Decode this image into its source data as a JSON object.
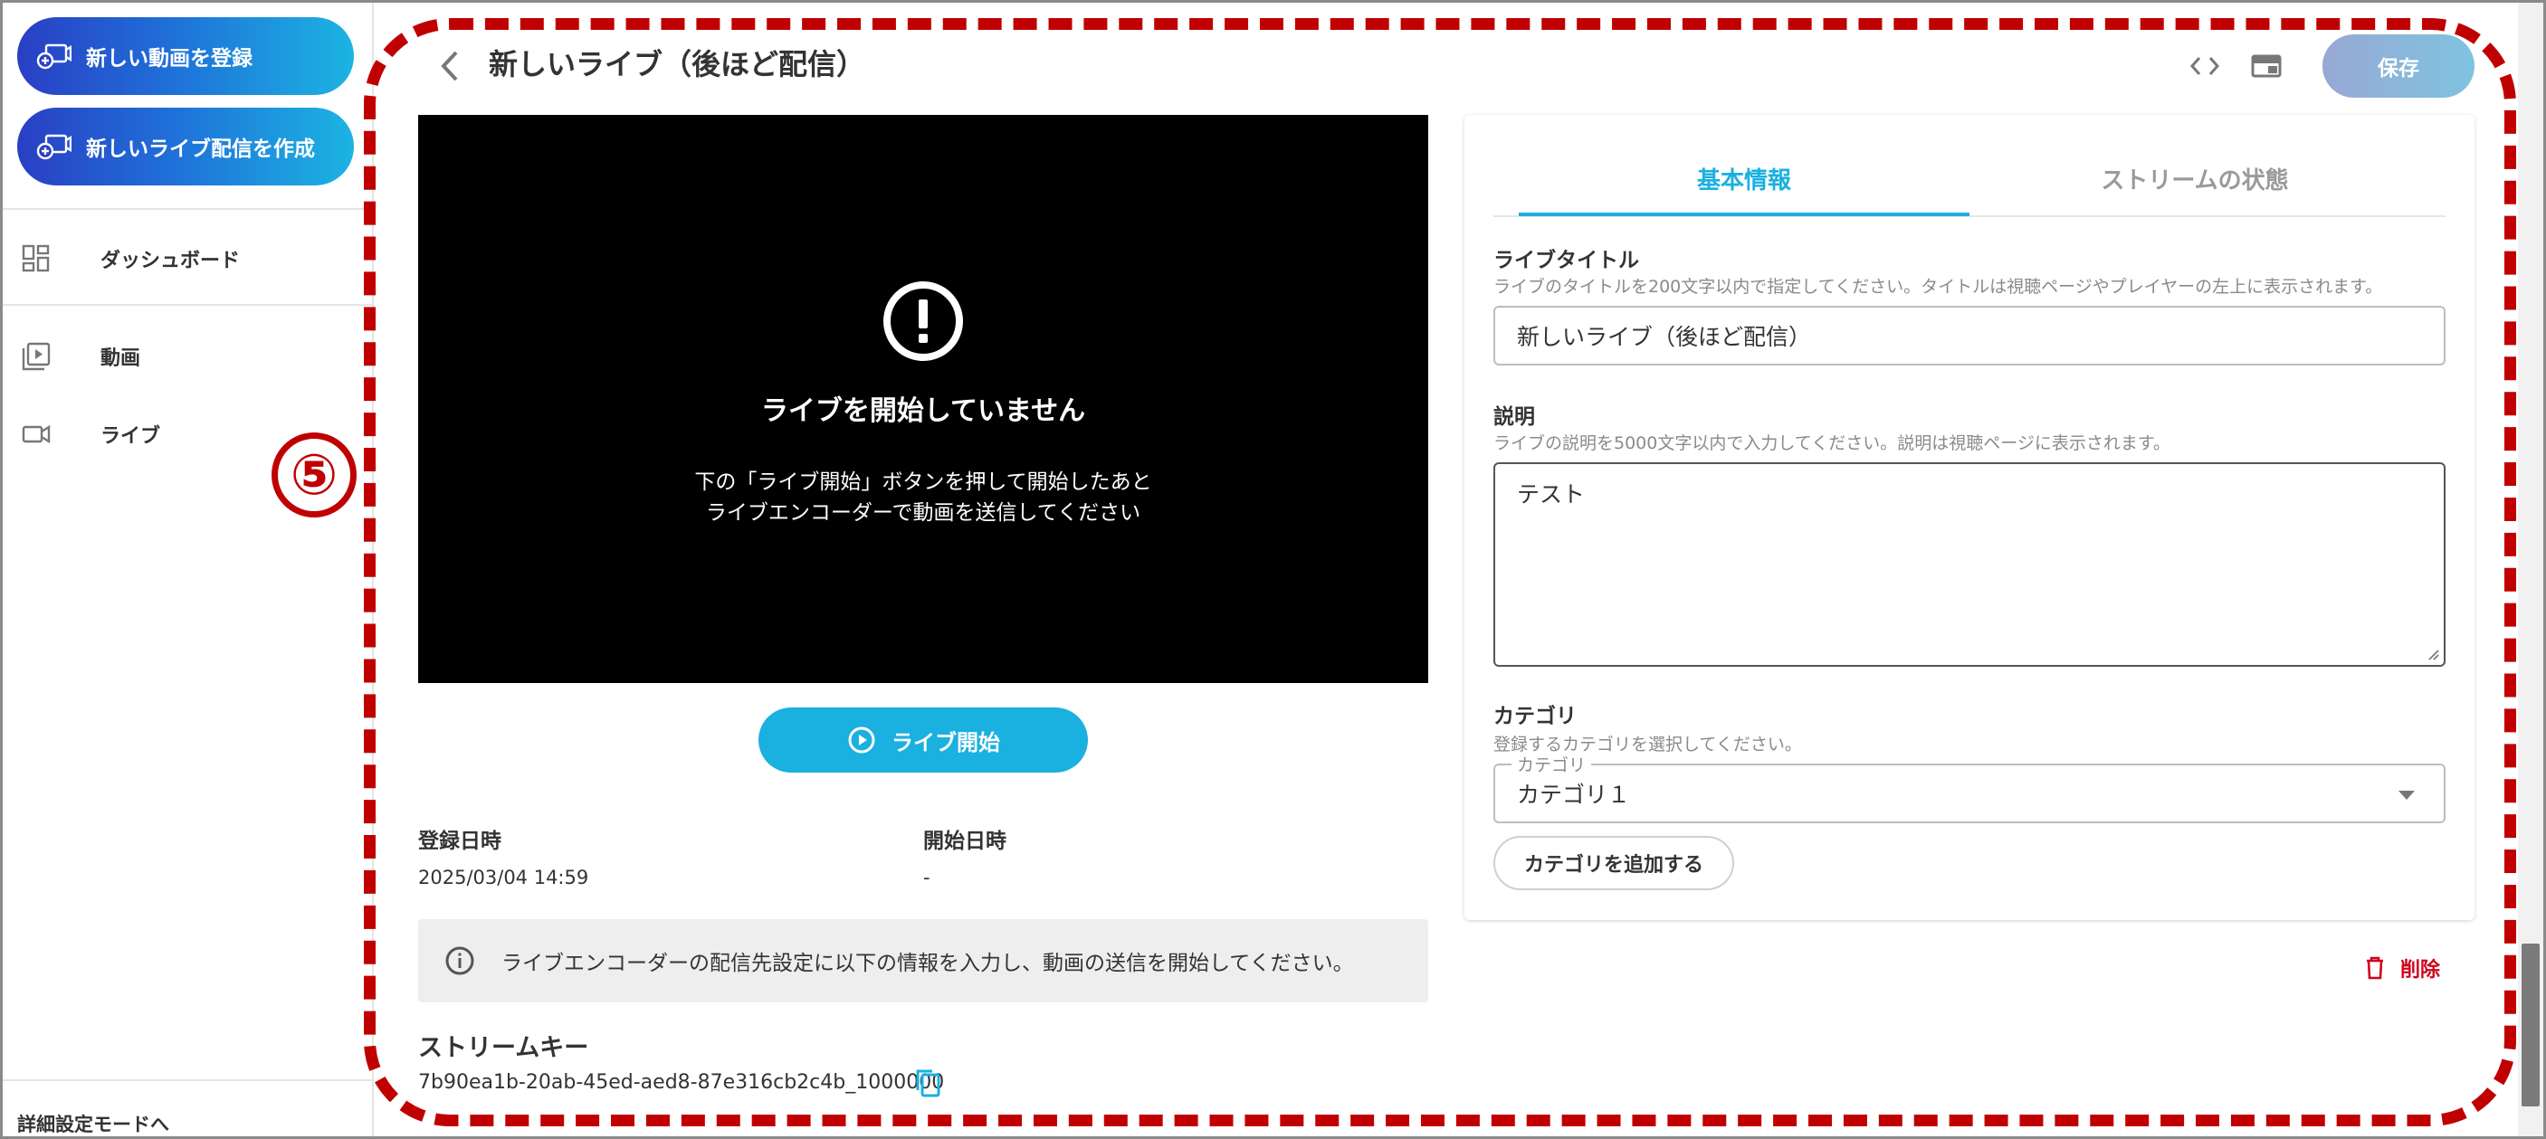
{
  "sidebar": {
    "new_video_button": "新しい動画を登録",
    "new_live_button": "新しいライブ配信を作成",
    "items": [
      {
        "label": "ダッシュボード",
        "icon": "dashboard-icon"
      },
      {
        "label": "動画",
        "icon": "video-library-icon"
      },
      {
        "label": "ライブ",
        "icon": "videocam-icon"
      }
    ],
    "footer_link": "詳細設定モードへ"
  },
  "annotation": {
    "number": "⑤",
    "color": "#c00000"
  },
  "header": {
    "title": "新しいライブ（後ほど配信）",
    "save_label": "保存"
  },
  "player": {
    "title": "ライブを開始していません",
    "description_line1": "下の「ライブ開始」ボタンを押して開始したあと",
    "description_line2": "ライブエンコーダーで動画を送信してください"
  },
  "start_button_label": "ライブ開始",
  "meta": {
    "registered_label": "登録日時",
    "registered_value": "2025/03/04 14:59",
    "started_label": "開始日時",
    "started_value": "-"
  },
  "info_message": "ライブエンコーダーの配信先設定に以下の情報を入力し、動画の送信を開始してください。",
  "stream": {
    "label": "ストリームキー",
    "key": "7b90ea1b-20ab-45ed-aed8-87e316cb2c4b_1000000"
  },
  "tabs": [
    {
      "label": "基本情報",
      "active": true
    },
    {
      "label": "ストリームの状態",
      "active": false
    }
  ],
  "form": {
    "title_label": "ライブタイトル",
    "title_help": "ライブのタイトルを200文字以内で指定してください。タイトルは視聴ページやプレイヤーの左上に表示されます。",
    "title_value": "新しいライブ（後ほど配信）",
    "description_label": "説明",
    "description_help": "ライブの説明を5000文字以内で入力してください。説明は視聴ページに表示されます。",
    "description_value": "テスト",
    "category_label": "カテゴリ",
    "category_help": "登録するカテゴリを選択してください。",
    "category_field_label": "カテゴリ",
    "category_value": "カテゴリ１",
    "add_category_label": "カテゴリを追加する"
  },
  "delete_label": "削除",
  "colors": {
    "accent": "#1ab0e0",
    "danger": "#d0021b",
    "gradient_start": "#2a3fc4",
    "gradient_end": "#1cb4e2"
  }
}
